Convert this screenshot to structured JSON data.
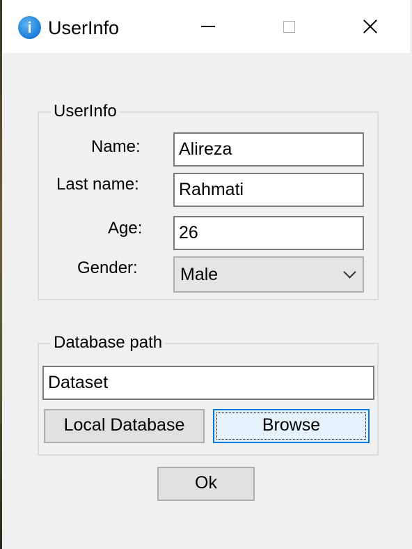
{
  "window": {
    "title": "UserInfo",
    "icon": "info-icon",
    "controls": {
      "minimize": "minimize-icon",
      "maximize": "maximize-icon",
      "close": "close-icon"
    }
  },
  "user_group": {
    "legend": "UserInfo",
    "name_label": "Name:",
    "name_value": "Alireza",
    "lastname_label": "Last name:",
    "lastname_value": "Rahmati",
    "age_label": "Age:",
    "age_value": "26",
    "gender_label": "Gender:",
    "gender_value": "Male"
  },
  "db_group": {
    "legend": "Database path",
    "path_value": "Dataset",
    "local_button": "Local Database",
    "browse_button": "Browse"
  },
  "ok_button": "Ok",
  "colors": {
    "focus_border": "#0078d7",
    "info_icon": "#1c7cd5"
  }
}
